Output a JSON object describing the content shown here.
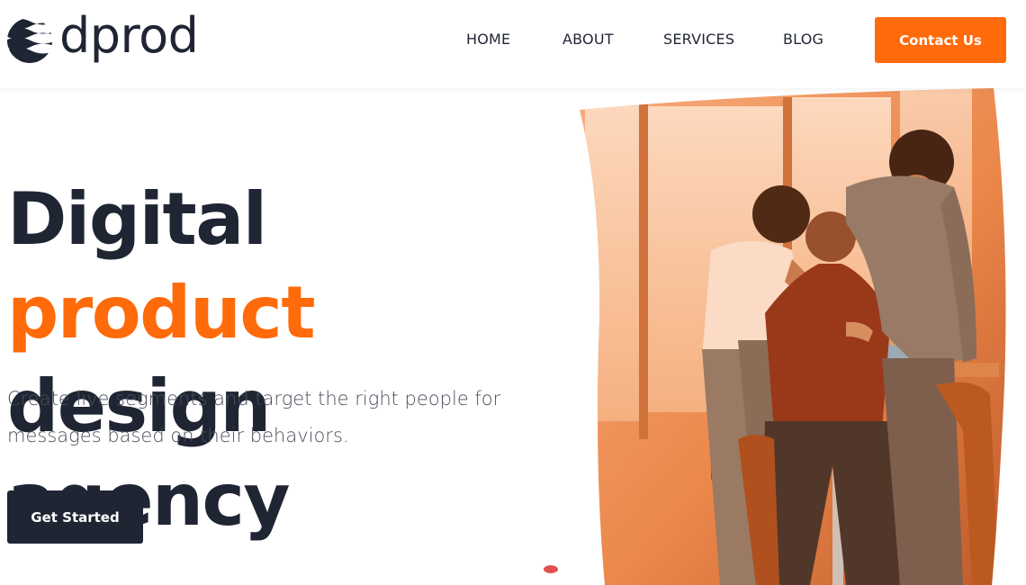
{
  "brand": {
    "name": "dprod"
  },
  "nav": {
    "items": [
      {
        "label": "HOME"
      },
      {
        "label": "ABOUT"
      },
      {
        "label": "SERVICES"
      },
      {
        "label": "BLOG"
      }
    ],
    "cta_label": "Contact Us"
  },
  "hero": {
    "title_part1": "Digital",
    "title_accent": "product",
    "title_part2": "design agency",
    "subtitle": "Create live segments and target the right people for messages based on their behaviors.",
    "button_label": "Get Started"
  },
  "colors": {
    "accent": "#ff6a0a",
    "dark": "#1f2533",
    "text_muted": "#4a4f5b"
  },
  "icons": {
    "logo": "wave-circle-logo-icon"
  }
}
